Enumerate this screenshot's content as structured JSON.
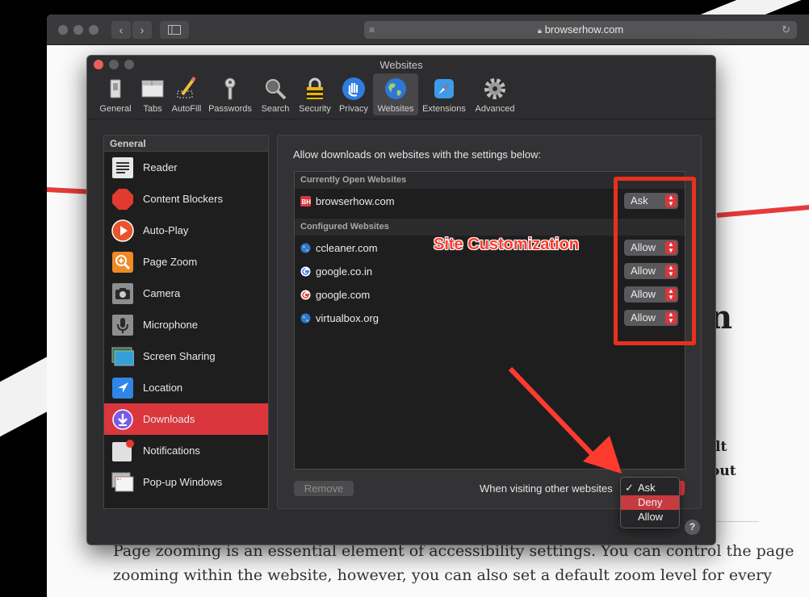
{
  "browser": {
    "url": "browserhow.com"
  },
  "background_page": {
    "paragraph_line1": "Page zooming is an essential element of accessibility settings. You can control the page",
    "paragraph_line2": "zooming within the website, however, you can also set a default zoom level for every",
    "side_text1": "lt",
    "side_text2": "out",
    "side_text3": "n"
  },
  "prefs": {
    "title": "Websites",
    "tabs": [
      {
        "label": "General",
        "icon": "switch-icon"
      },
      {
        "label": "Tabs",
        "icon": "tabs-icon"
      },
      {
        "label": "AutoFill",
        "icon": "pencil-icon"
      },
      {
        "label": "Passwords",
        "icon": "key-icon"
      },
      {
        "label": "Search",
        "icon": "magnifier-icon"
      },
      {
        "label": "Security",
        "icon": "lock-icon"
      },
      {
        "label": "Privacy",
        "icon": "hand-icon"
      },
      {
        "label": "Websites",
        "icon": "globe-icon"
      },
      {
        "label": "Extensions",
        "icon": "compass-icon"
      },
      {
        "label": "Advanced",
        "icon": "gear-icon"
      }
    ],
    "active_tab": "Websites",
    "sidebar": {
      "header": "General",
      "items": [
        {
          "label": "Reader",
          "icon": "reader-icon"
        },
        {
          "label": "Content Blockers",
          "icon": "stop-icon"
        },
        {
          "label": "Auto-Play",
          "icon": "play-icon"
        },
        {
          "label": "Page Zoom",
          "icon": "zoom-icon"
        },
        {
          "label": "Camera",
          "icon": "camera-icon"
        },
        {
          "label": "Microphone",
          "icon": "microphone-icon"
        },
        {
          "label": "Screen Sharing",
          "icon": "screen-icon"
        },
        {
          "label": "Location",
          "icon": "location-icon"
        },
        {
          "label": "Downloads",
          "icon": "download-icon"
        },
        {
          "label": "Notifications",
          "icon": "notification-icon"
        },
        {
          "label": "Pop-up Windows",
          "icon": "popup-icon"
        }
      ],
      "active": "Downloads"
    },
    "panel": {
      "description": "Allow downloads on websites with the settings below:",
      "current_header": "Currently Open Websites",
      "current_sites": [
        {
          "name": "browserhow.com",
          "value": "Ask",
          "favicon": "bh-icon"
        }
      ],
      "configured_header": "Configured Websites",
      "configured_sites": [
        {
          "name": "ccleaner.com",
          "value": "Allow",
          "favicon": "globe-icon"
        },
        {
          "name": "google.co.in",
          "value": "Allow",
          "favicon": "google-icon"
        },
        {
          "name": "google.com",
          "value": "Allow",
          "favicon": "google-icon"
        },
        {
          "name": "virtualbox.org",
          "value": "Allow",
          "favicon": "globe-icon"
        }
      ],
      "remove_label": "Remove",
      "other_label": "When visiting other websites",
      "dropdown_options": [
        "Ask",
        "Deny",
        "Allow"
      ],
      "dropdown_checked": "Ask",
      "dropdown_highlight": "Deny",
      "help_label": "?"
    }
  },
  "annotation": {
    "text": "Site Customization",
    "color": "#e8301f"
  }
}
